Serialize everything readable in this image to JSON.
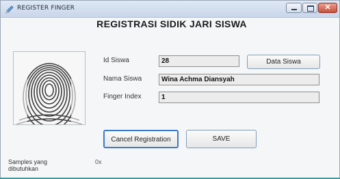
{
  "window": {
    "title": "REGISTER FINGER"
  },
  "form": {
    "heading": "REGISTRASI SIDIK JARI SISWA"
  },
  "fields": {
    "id_label": "Id Siswa",
    "id_value": "28",
    "name_label": "Nama Siswa",
    "name_value": "Wina Achma Diansyah",
    "finger_label": "Finger Index",
    "finger_value": "1"
  },
  "buttons": {
    "data_siswa": "Data Siswa",
    "cancel": "Cancel Registration",
    "save": "SAVE"
  },
  "footer": {
    "samples_label": "Samples yang dibutuhkan",
    "samples_value": "0x"
  },
  "icons": {
    "app": "pen-icon",
    "minimize": "minimize-icon",
    "maximize": "maximize-icon",
    "close": "close-icon",
    "fingerprint": "fingerprint-image"
  }
}
